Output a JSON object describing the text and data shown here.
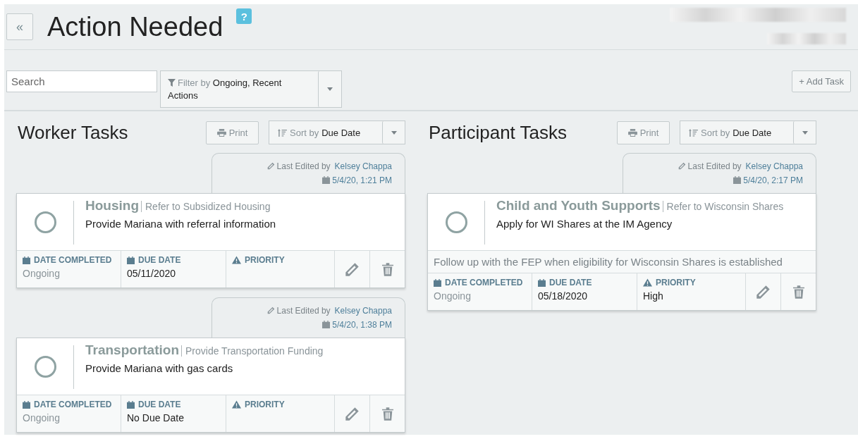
{
  "header": {
    "collapse_button": "«",
    "title": "Action Needed",
    "help_badge": "?"
  },
  "toolbar": {
    "search": {
      "placeholder": "Search"
    },
    "filter": {
      "label": "Filter by",
      "value": "Ongoing, Recent Actions"
    },
    "add_button": "+ Add Task"
  },
  "panels": [
    {
      "title": "Worker Tasks",
      "print_button": "Print",
      "sort": {
        "label": "Sort by",
        "value": "Due Date"
      },
      "tasks": [
        {
          "edited_label": "Last Edited by",
          "edited_by": "Kelsey Chappa",
          "edited_at": "5/4/20, 1:21 PM",
          "completed": false,
          "category": "Housing",
          "subcategory": "Refer to Subsidized Housing",
          "description": "Provide Mariana with referral information",
          "fields": [
            {
              "kind": "date_completed",
              "label": "DATE COMPLETED",
              "value": "Ongoing"
            },
            {
              "kind": "due_date",
              "label": "DUE DATE",
              "value": "05/11/2020"
            },
            {
              "kind": "priority",
              "label": "PRIORITY"
            }
          ]
        },
        {
          "edited_label": "Last Edited by",
          "edited_by": "Kelsey Chappa",
          "edited_at": "5/4/20, 1:38 PM",
          "completed": false,
          "category": "Transportation",
          "subcategory": "Provide Transportation Funding",
          "description": "Provide Mariana with gas cards",
          "fields": [
            {
              "kind": "date_completed",
              "label": "DATE COMPLETED",
              "value": "Ongoing"
            },
            {
              "kind": "due_date",
              "label": "DUE DATE",
              "value": "No Due Date"
            },
            {
              "kind": "priority",
              "label": "PRIORITY"
            }
          ]
        }
      ]
    },
    {
      "title": "Participant Tasks",
      "print_button": "Print",
      "sort": {
        "label": "Sort by",
        "value": "Due Date"
      },
      "tasks": [
        {
          "edited_label": "Last Edited by",
          "edited_by": "Kelsey Chappa",
          "edited_at": "5/4/20, 2:17 PM",
          "completed": false,
          "category": "Child and Youth Supports",
          "subcategory": "Refer to Wisconsin Shares",
          "description": "Apply for WI Shares at the IM Agency",
          "note": "Follow up with the FEP when eligibility for Wisconsin Shares is established",
          "fields": [
            {
              "kind": "date_completed",
              "label": "DATE COMPLETED",
              "value": "Ongoing"
            },
            {
              "kind": "due_date",
              "label": "DUE DATE",
              "value": "05/18/2020"
            },
            {
              "kind": "priority",
              "label": "PRIORITY",
              "value": "High"
            }
          ]
        }
      ]
    }
  ]
}
